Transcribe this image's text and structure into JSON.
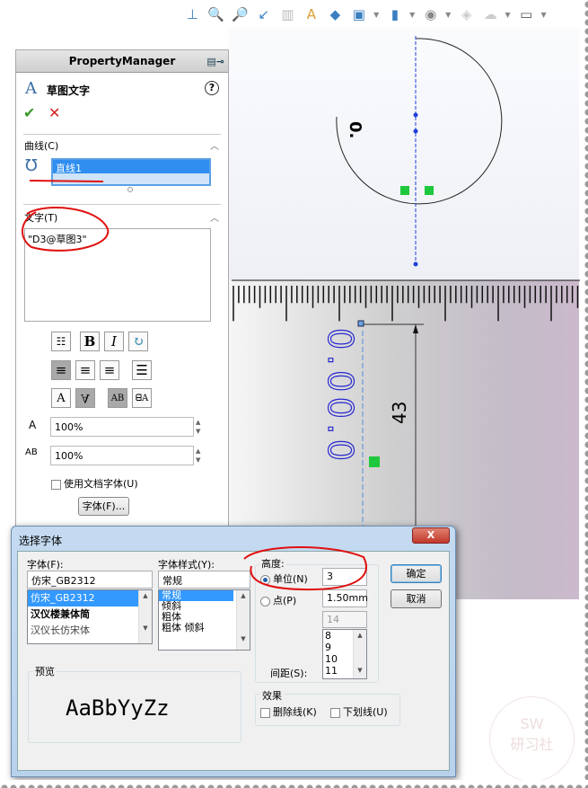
{
  "toolbar": {
    "icons": [
      "normal-to",
      "zoom-fit",
      "zoom-area",
      "previous-view",
      "section-view",
      "dynamic-annotation",
      "view-orientation",
      "display-style",
      "hide-show",
      "edit-appearance",
      "apply-scene",
      "view-settings"
    ]
  },
  "graphics": {
    "text_vertical": "0.00.0",
    "small_text": "0.",
    "dimension": "43"
  },
  "pm": {
    "header": "PropertyManager",
    "title": "草图文字",
    "help": "?",
    "ok": "✔",
    "cancel": "✕",
    "curve_section": "曲线(C)",
    "curve_item": "直线1",
    "text_section": "文字(T)",
    "text_value": "\"D3@草图3\"",
    "width_factor": "100%",
    "spacing": "100%",
    "use_doc_font": "使用文档字体(U)",
    "font_button": "字体(F)..."
  },
  "dialog": {
    "title": "选择字体",
    "close": "X",
    "font_label": "字体(F):",
    "font_value": "仿宋_GB2312",
    "font_list": [
      "仿宋_GB2312",
      "汉仪楼兼体简",
      "汉仪长仿宋体"
    ],
    "style_label": "字体样式(Y):",
    "style_value": "常规",
    "style_list": [
      "常规",
      "倾斜",
      "粗体",
      "粗体 倾斜"
    ],
    "height_label": "高度:",
    "units_label": "单位(N)",
    "units_value": "3",
    "points_label": "点(P)",
    "points_value": "1.50mm",
    "points_size": "14",
    "size_list": [
      "8",
      "9",
      "10",
      "11"
    ],
    "spacing_label": "间距(S):",
    "ok": "确定",
    "cancel": "取消",
    "preview_label": "预览",
    "preview_text": "AaBbYyZz",
    "effects_label": "效果",
    "strikeout": "删除线(K)",
    "underline": "下划线(U)"
  },
  "watermark": {
    "text": "SW 研习社"
  }
}
